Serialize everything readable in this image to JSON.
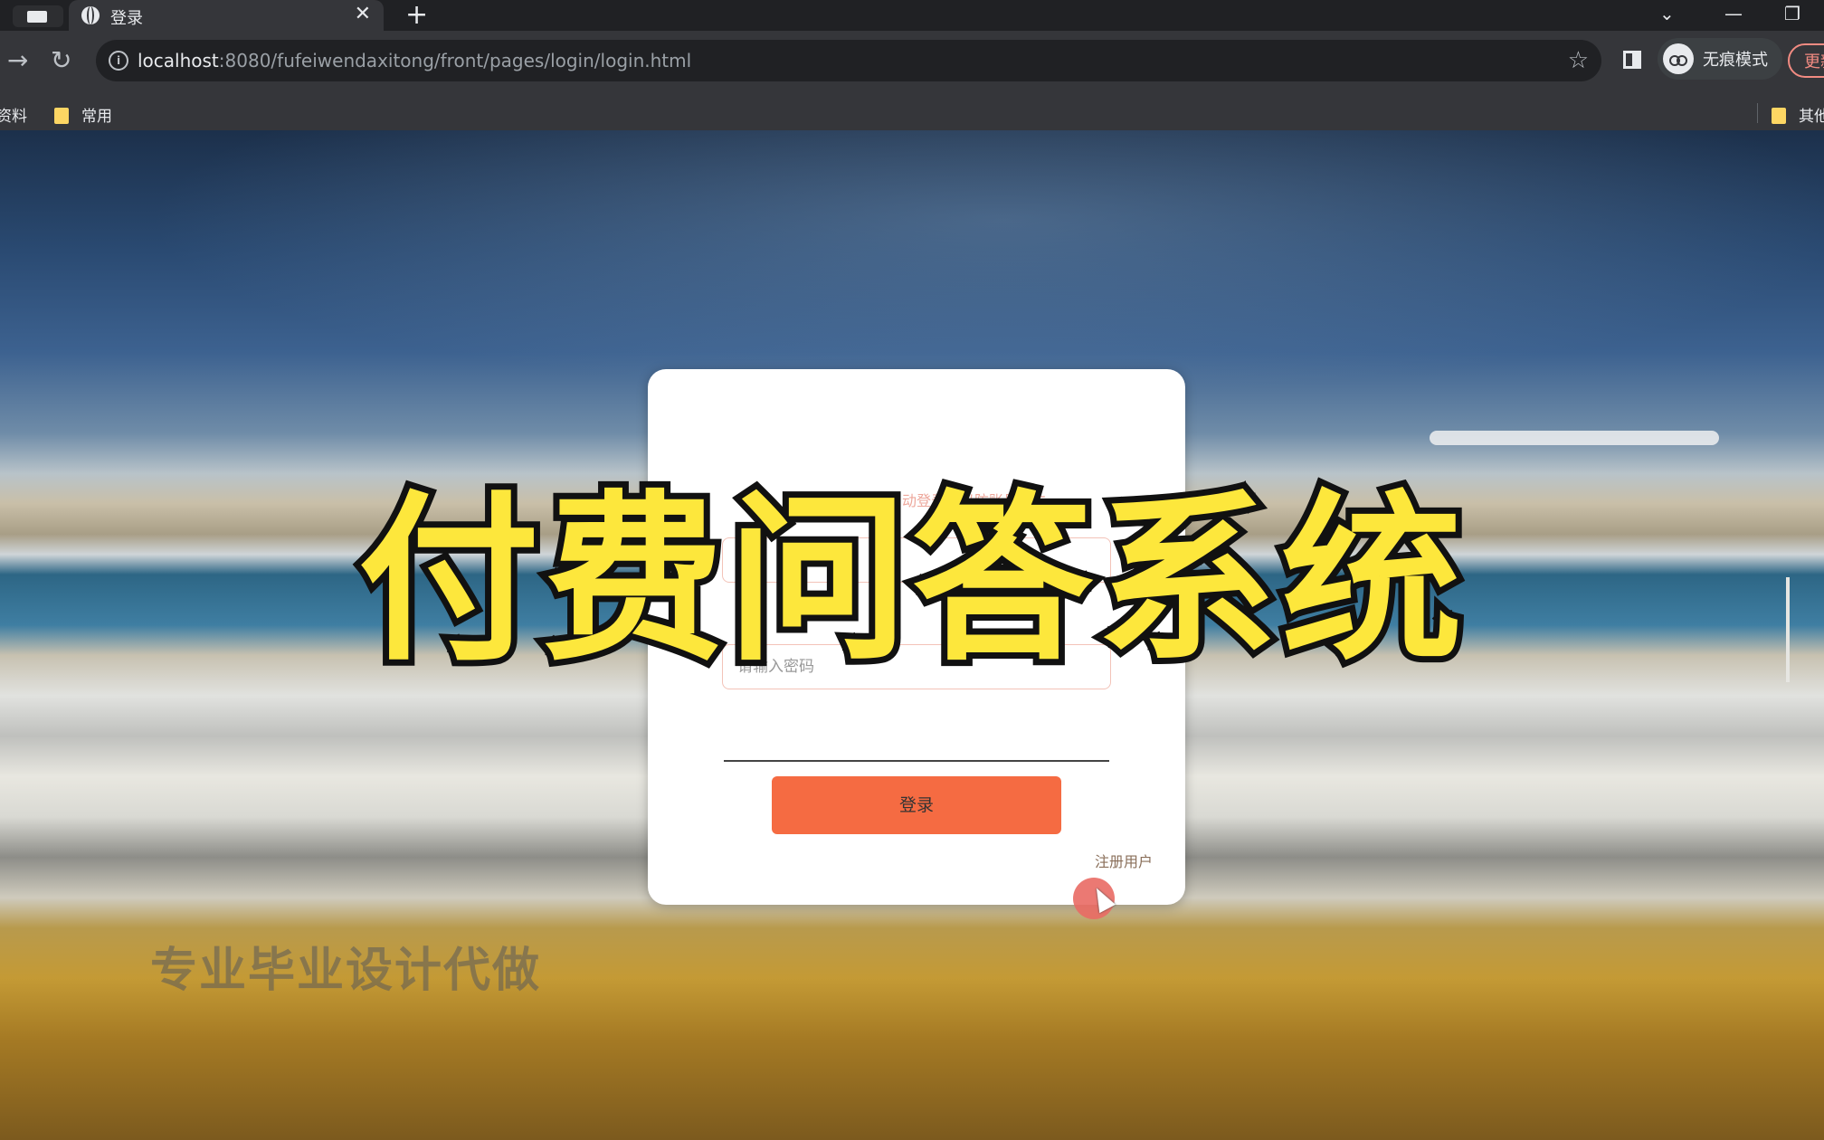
{
  "browser": {
    "tab": {
      "title": "登录",
      "close": "✕"
    },
    "new_tab": "+",
    "window_controls": {
      "dropdown": "⌄",
      "minimize": "—",
      "restore": "❐"
    },
    "nav": {
      "forward": "→",
      "reload": "↻"
    },
    "url": {
      "host": "localhost",
      "rest": ":8080/fufeiwendaxitong/front/pages/login/login.html"
    },
    "star": "☆",
    "incognito_label": "无痕模式",
    "update_label": "更新",
    "bookmarks": [
      {
        "label": "资料"
      },
      {
        "label": "常用"
      },
      {
        "label": "其他"
      }
    ]
  },
  "login_card": {
    "title": "公共场所不建议自动登录，以防账号丢失",
    "username_placeholder": "",
    "password_placeholder": "请输入密码",
    "login_button": "登录",
    "register_link": "注册用户"
  },
  "overlay": {
    "title": "付费问答系统",
    "watermark": "专业毕业设计代做"
  }
}
